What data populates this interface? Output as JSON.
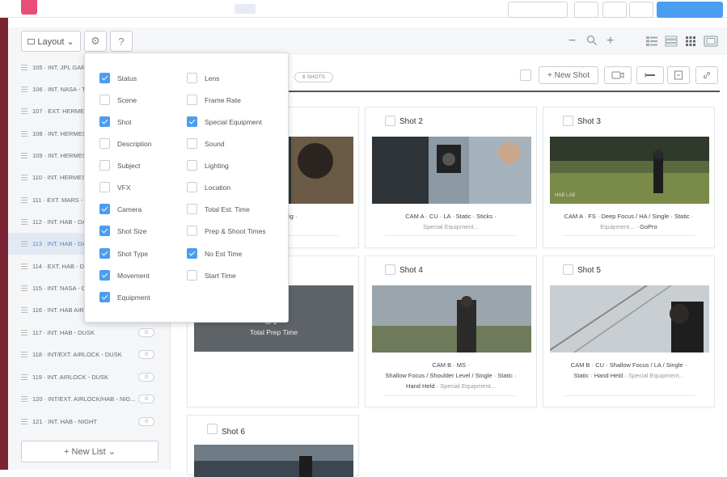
{
  "toolbar": {
    "layout_label": "Layout ⌄",
    "help_label": "?",
    "zoom_out": "−",
    "zoom_in": "+"
  },
  "sidebar": {
    "scenes": [
      {
        "label": "105 · INT. JPL GARA",
        "count": ""
      },
      {
        "label": "106 · INT. NASA - T",
        "count": ""
      },
      {
        "label": "107 · EXT. HERMES",
        "count": ""
      },
      {
        "label": "108 · INT. HERMES",
        "count": ""
      },
      {
        "label": "109 · INT. HERMES",
        "count": ""
      },
      {
        "label": "110 · INT. HERMES",
        "count": ""
      },
      {
        "label": "111 · EXT. MARS - S",
        "count": ""
      },
      {
        "label": "112 · INT. HAB - DA",
        "count": ""
      },
      {
        "label": "113 · INT. HAB - DA",
        "count": "",
        "active": true
      },
      {
        "label": "114 · EXT. HAB - DA",
        "count": ""
      },
      {
        "label": "115 · INT. NASA - C",
        "count": ""
      },
      {
        "label": "116 · INT. HAB AIRL",
        "count": ""
      },
      {
        "label": "117 · INT. HAB - DUSK",
        "count": "0"
      },
      {
        "label": "118 · INT/EXT. AIRLOCK - DUSK",
        "count": "0"
      },
      {
        "label": "119 · INT. AIRLOCK - DUSK",
        "count": "0"
      },
      {
        "label": "120 · INT/EXT. AIRLOCK/HAB - NIG...",
        "count": "0"
      },
      {
        "label": "121 · INT. HAB - NIGHT",
        "count": "0"
      }
    ],
    "new_list_label": "+ New List ⌄"
  },
  "header": {
    "shots_badge": "6 SHOTS",
    "new_shot_label": "+ New Shot"
  },
  "dropdown": {
    "left": [
      {
        "label": "Status",
        "checked": true
      },
      {
        "label": "Scene",
        "checked": false
      },
      {
        "label": "Shot",
        "checked": true
      },
      {
        "label": "Description",
        "checked": false
      },
      {
        "label": "Subject",
        "checked": false
      },
      {
        "label": "VFX",
        "checked": false
      },
      {
        "label": "Camera",
        "checked": true
      },
      {
        "label": "Shot Size",
        "checked": true
      },
      {
        "label": "Shot Type",
        "checked": true
      },
      {
        "label": "Movement",
        "checked": true
      },
      {
        "label": "Equipment",
        "checked": true
      }
    ],
    "right": [
      {
        "label": "Lens",
        "checked": false
      },
      {
        "label": "Frame Rate",
        "checked": false
      },
      {
        "label": "Special Equipment",
        "checked": true
      },
      {
        "label": "Sound",
        "checked": false
      },
      {
        "label": "Lighting",
        "checked": false
      },
      {
        "label": "Location",
        "checked": false
      },
      {
        "label": "Total Est. Time",
        "checked": false
      },
      {
        "label": "Prep & Shoot Times",
        "checked": false
      },
      {
        "label": "No Est Time",
        "checked": true
      },
      {
        "label": "Start Time",
        "checked": false
      }
    ]
  },
  "cards": {
    "shot1": {
      "meta1": "tatic · GoPro Rig ·"
    },
    "shot2": {
      "title": "Shot 2",
      "meta1": "CAM A · CU · LA · Static · Sticks ·",
      "meta2": "Special Equipment..."
    },
    "shot3": {
      "title": "Shot 3",
      "meta1": "CAM A · FS · Deep Focus / HA / Single · Static ·",
      "meta2a": "Equipment... · ",
      "meta2b": "GoPro",
      "overlay": "HAB LAB"
    },
    "prep": {
      "line1": "of 1",
      "line2": "Total Prep Time"
    },
    "shot4": {
      "title": "Shot 4",
      "meta1": "CAM B · MS ·",
      "meta2": "Shallow Focus / Shoulder Level / Single · Static ·",
      "meta3a": "Hand Held · ",
      "meta3b": "Special Equipment..."
    },
    "shot5": {
      "title": "Shot 5",
      "meta1": "CAM B · CU · Shallow Focus / LA / Single ·",
      "meta2a": "Static · Hand Held · ",
      "meta2b": "Special Equipment..."
    },
    "shot6": {
      "title": "Shot 6"
    }
  },
  "colors": {
    "accent": "#4a9df0",
    "edge": "#7b2434",
    "brand": "#e94e77"
  }
}
